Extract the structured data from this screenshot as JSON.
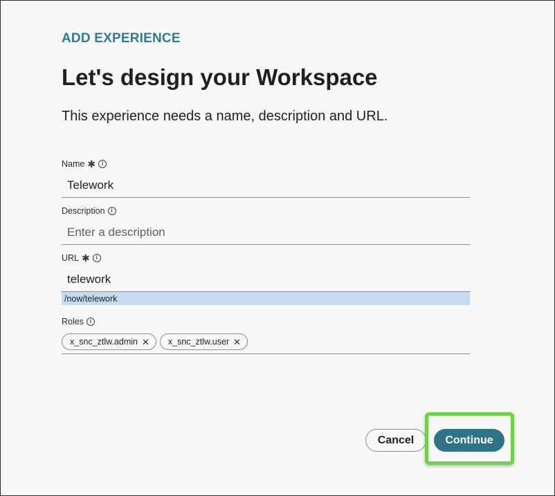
{
  "header": {
    "eyebrow": "ADD EXPERIENCE",
    "title": "Let's design your Workspace",
    "subtitle": "This experience needs a name, description and URL."
  },
  "form": {
    "name": {
      "label": "Name",
      "required": true,
      "value": "Telework"
    },
    "description": {
      "label": "Description",
      "placeholder": "Enter a description",
      "value": ""
    },
    "url": {
      "label": "URL",
      "required": true,
      "value": "telework",
      "preview": "/now/telework"
    },
    "roles": {
      "label": "Roles",
      "chips": [
        "x_snc_ztlw.admin",
        "x_snc_ztlw.user"
      ]
    }
  },
  "icons": {
    "required": "asterisk-icon",
    "info": "info-icon",
    "remove": "close-icon"
  },
  "actions": {
    "cancel_label": "Cancel",
    "continue_label": "Continue"
  },
  "colors": {
    "accent": "#2e7d8e",
    "primary_button": "#2e7489",
    "highlight": "#6fd24a",
    "url_preview_bg": "#c6dbef"
  }
}
